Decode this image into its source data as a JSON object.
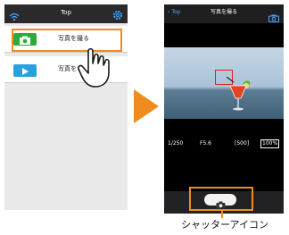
{
  "left_screen": {
    "title": "Top",
    "icons": {
      "connection": "wifi-icon",
      "settings": "gear-icon"
    },
    "menu": [
      {
        "label": "写真を撮る",
        "icon": "camera-icon",
        "color": "#2faa3a"
      },
      {
        "label": "写真を",
        "icon": "play-icon",
        "color": "#2aa0df"
      }
    ]
  },
  "right_screen": {
    "back_label": "Top",
    "title": "写真を撮る",
    "info": {
      "shutter_speed": "1/250",
      "aperture": "F5.6",
      "remaining_shots": "[500]",
      "battery": "100%"
    }
  },
  "caption": "シャッターアイコン",
  "colors": {
    "highlight": "#f08b1e",
    "arrow": "#f08b1e",
    "focus_box": "#e02020"
  }
}
